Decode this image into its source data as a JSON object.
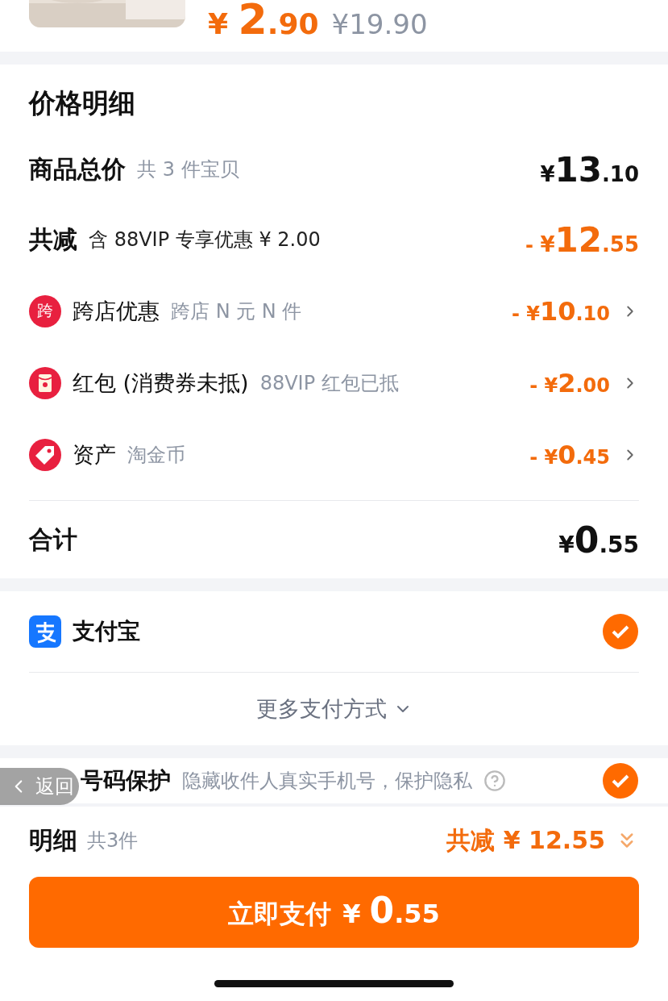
{
  "product": {
    "kind": "picture",
    "price": {
      "currency": "¥",
      "integer": "2",
      "decimal": ".90"
    },
    "original_price": "¥19.90"
  },
  "price_details": {
    "title": "价格明细",
    "subtotal": {
      "label": "商品总价",
      "note": "共 3 件宝贝",
      "amount": {
        "currency": "¥",
        "integer": "13",
        "decimal": ".10"
      }
    },
    "discount_total": {
      "label": "共减",
      "note": "含 88VIP 专享优惠 ¥ 2.00",
      "amount": {
        "sign": "-",
        "currency": "¥",
        "integer": "12",
        "decimal": ".55"
      }
    },
    "discounts": [
      {
        "kind": "badge",
        "badge": "跨",
        "label": "跨店优惠",
        "note": "跨店 N 元 N 件",
        "amount": {
          "sign": "-",
          "currency": "¥",
          "integer": "10",
          "decimal": ".10"
        }
      },
      {
        "kind": "redpacket",
        "label": "红包 (消费券未抵)",
        "note": "88VIP 红包已抵",
        "amount": {
          "sign": "-",
          "currency": "¥",
          "integer": "2",
          "decimal": ".00"
        }
      },
      {
        "kind": "tag",
        "label": "资产",
        "note": "淘金币",
        "amount": {
          "sign": "-",
          "currency": "¥",
          "integer": "0",
          "decimal": ".45"
        }
      }
    ],
    "total": {
      "label": "合计",
      "amount": {
        "currency": "¥",
        "integer": "0",
        "decimal": ".55"
      }
    }
  },
  "payment": {
    "methods": [
      {
        "label": "支付宝",
        "selected": true
      }
    ],
    "more": "更多支付方式"
  },
  "privacy": {
    "label": "号码保护",
    "note": "隐藏收件人真实手机号，保护隐私",
    "checked": true
  },
  "back_button": "返回",
  "bottom_bar": {
    "label": "明细",
    "count": "共3件",
    "discount": "共减 ¥ 12.55",
    "pay_button": {
      "label": "立即支付",
      "currency": "¥",
      "integer": "0",
      "decimal": ".55"
    }
  }
}
